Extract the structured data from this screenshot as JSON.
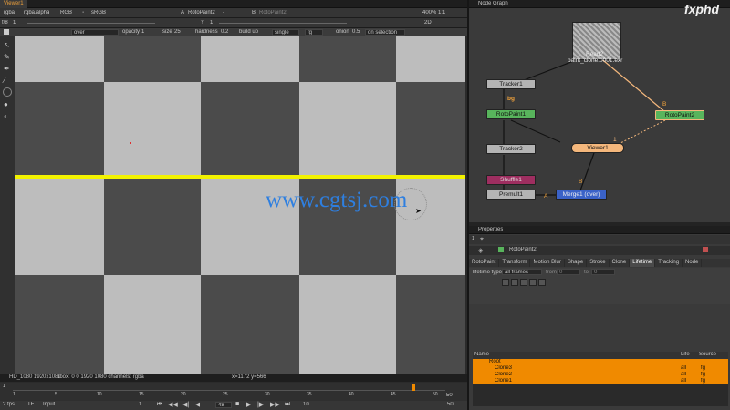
{
  "viewer": {
    "tab": "Viewer1",
    "channels": "rgba",
    "alpha": "rgba.alpha",
    "colorspace": "RGB",
    "lut": "sRGB",
    "input_a": "A",
    "input_a_node": "RotoPaint2",
    "input_a_sep": "-",
    "input_b": "B",
    "input_b_node": "RotoPaint2",
    "zoom": "400%",
    "ratio": "1:1",
    "view_mode": "2D",
    "exposure_label": "f/8",
    "exposure_value": "1",
    "gamma_label": "Y",
    "gamma_value": "1",
    "paint_blend": "over",
    "opacity_label": "opacity",
    "opacity_value": "1",
    "size_label": "size",
    "size_value": "25",
    "hardness_label": "hardness",
    "hardness_value": "0.2",
    "buildup_label": "build up",
    "lifetime_mode": "single",
    "fg": "fg",
    "onion_label": "onion",
    "onion_value": "0.5",
    "on_selection": "on selection",
    "status_format": "HD_1080 1920x1080",
    "status_bbox": "bbox: 0 0 1920 1080 channels: rgba",
    "status_coords": "x=1172 y=566",
    "fps": "? fps",
    "tf": "TF",
    "input_mode": "Input",
    "frame_current": "48",
    "frame_step": "10",
    "frame_end": "50",
    "frame_start_field": "1",
    "timeline_start": "1",
    "timeline_ticks": [
      "1",
      "5",
      "10",
      "15",
      "20",
      "25",
      "30",
      "35",
      "40",
      "45",
      "50"
    ]
  },
  "watermark": "www.cgtsj.com",
  "node_graph": {
    "tab": "Node Graph",
    "brand": "fxphd",
    "nodes": {
      "read": "Read2",
      "read_file": "paint_clone.0001.exr",
      "tracker1": "Tracker1",
      "rotopaint1": "RotoPaint1",
      "rotopaint2": "RotoPaint2",
      "tracker2": "Tracker2",
      "viewer": "Viewer1",
      "shuffle": "Shuffle1",
      "premult": "Premult1",
      "merge": "Merge1 (over)"
    },
    "labels": {
      "bg": "bg",
      "b1": "B",
      "b2": "B",
      "a": "A",
      "a2": "A",
      "num": "1"
    }
  },
  "properties": {
    "tab": "Properties",
    "count": "1",
    "node_name": "RotoPaint2",
    "tabs": [
      "RotoPaint",
      "Transform",
      "Motion Blur",
      "Shape",
      "Stroke",
      "Clone",
      "Lifetime",
      "Tracking",
      "Node"
    ],
    "active_tab": "Lifetime",
    "lifetime_type_label": "lifetime type",
    "lifetime_type_value": "all frames",
    "from_label": "from",
    "from_value": "0",
    "to_label": "to",
    "to_value": "0",
    "tree_headers": {
      "name": "Name",
      "life": "Life",
      "source": "Source"
    },
    "tree_rows": [
      {
        "name": "Root",
        "life": "",
        "source": ""
      },
      {
        "name": "Clone3",
        "life": "all",
        "source": "fg"
      },
      {
        "name": "Clone2",
        "life": "all",
        "source": "fg"
      },
      {
        "name": "Clone1",
        "life": "all",
        "source": "fg"
      }
    ]
  },
  "colors": {
    "accent": "#f08a00",
    "yellow_stroke": "#f2f200",
    "watermark": "#2e7fe0"
  }
}
